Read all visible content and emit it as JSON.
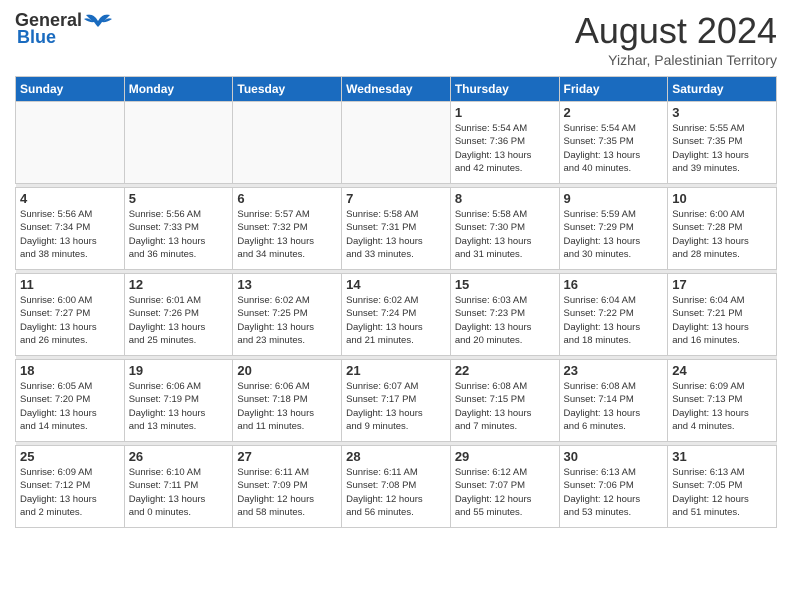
{
  "header": {
    "logo_general": "General",
    "logo_blue": "Blue",
    "month_year": "August 2024",
    "location": "Yizhar, Palestinian Territory"
  },
  "weekdays": [
    "Sunday",
    "Monday",
    "Tuesday",
    "Wednesday",
    "Thursday",
    "Friday",
    "Saturday"
  ],
  "weeks": [
    [
      {
        "day": "",
        "info": ""
      },
      {
        "day": "",
        "info": ""
      },
      {
        "day": "",
        "info": ""
      },
      {
        "day": "",
        "info": ""
      },
      {
        "day": "1",
        "info": "Sunrise: 5:54 AM\nSunset: 7:36 PM\nDaylight: 13 hours\nand 42 minutes."
      },
      {
        "day": "2",
        "info": "Sunrise: 5:54 AM\nSunset: 7:35 PM\nDaylight: 13 hours\nand 40 minutes."
      },
      {
        "day": "3",
        "info": "Sunrise: 5:55 AM\nSunset: 7:35 PM\nDaylight: 13 hours\nand 39 minutes."
      }
    ],
    [
      {
        "day": "4",
        "info": "Sunrise: 5:56 AM\nSunset: 7:34 PM\nDaylight: 13 hours\nand 38 minutes."
      },
      {
        "day": "5",
        "info": "Sunrise: 5:56 AM\nSunset: 7:33 PM\nDaylight: 13 hours\nand 36 minutes."
      },
      {
        "day": "6",
        "info": "Sunrise: 5:57 AM\nSunset: 7:32 PM\nDaylight: 13 hours\nand 34 minutes."
      },
      {
        "day": "7",
        "info": "Sunrise: 5:58 AM\nSunset: 7:31 PM\nDaylight: 13 hours\nand 33 minutes."
      },
      {
        "day": "8",
        "info": "Sunrise: 5:58 AM\nSunset: 7:30 PM\nDaylight: 13 hours\nand 31 minutes."
      },
      {
        "day": "9",
        "info": "Sunrise: 5:59 AM\nSunset: 7:29 PM\nDaylight: 13 hours\nand 30 minutes."
      },
      {
        "day": "10",
        "info": "Sunrise: 6:00 AM\nSunset: 7:28 PM\nDaylight: 13 hours\nand 28 minutes."
      }
    ],
    [
      {
        "day": "11",
        "info": "Sunrise: 6:00 AM\nSunset: 7:27 PM\nDaylight: 13 hours\nand 26 minutes."
      },
      {
        "day": "12",
        "info": "Sunrise: 6:01 AM\nSunset: 7:26 PM\nDaylight: 13 hours\nand 25 minutes."
      },
      {
        "day": "13",
        "info": "Sunrise: 6:02 AM\nSunset: 7:25 PM\nDaylight: 13 hours\nand 23 minutes."
      },
      {
        "day": "14",
        "info": "Sunrise: 6:02 AM\nSunset: 7:24 PM\nDaylight: 13 hours\nand 21 minutes."
      },
      {
        "day": "15",
        "info": "Sunrise: 6:03 AM\nSunset: 7:23 PM\nDaylight: 13 hours\nand 20 minutes."
      },
      {
        "day": "16",
        "info": "Sunrise: 6:04 AM\nSunset: 7:22 PM\nDaylight: 13 hours\nand 18 minutes."
      },
      {
        "day": "17",
        "info": "Sunrise: 6:04 AM\nSunset: 7:21 PM\nDaylight: 13 hours\nand 16 minutes."
      }
    ],
    [
      {
        "day": "18",
        "info": "Sunrise: 6:05 AM\nSunset: 7:20 PM\nDaylight: 13 hours\nand 14 minutes."
      },
      {
        "day": "19",
        "info": "Sunrise: 6:06 AM\nSunset: 7:19 PM\nDaylight: 13 hours\nand 13 minutes."
      },
      {
        "day": "20",
        "info": "Sunrise: 6:06 AM\nSunset: 7:18 PM\nDaylight: 13 hours\nand 11 minutes."
      },
      {
        "day": "21",
        "info": "Sunrise: 6:07 AM\nSunset: 7:17 PM\nDaylight: 13 hours\nand 9 minutes."
      },
      {
        "day": "22",
        "info": "Sunrise: 6:08 AM\nSunset: 7:15 PM\nDaylight: 13 hours\nand 7 minutes."
      },
      {
        "day": "23",
        "info": "Sunrise: 6:08 AM\nSunset: 7:14 PM\nDaylight: 13 hours\nand 6 minutes."
      },
      {
        "day": "24",
        "info": "Sunrise: 6:09 AM\nSunset: 7:13 PM\nDaylight: 13 hours\nand 4 minutes."
      }
    ],
    [
      {
        "day": "25",
        "info": "Sunrise: 6:09 AM\nSunset: 7:12 PM\nDaylight: 13 hours\nand 2 minutes."
      },
      {
        "day": "26",
        "info": "Sunrise: 6:10 AM\nSunset: 7:11 PM\nDaylight: 13 hours\nand 0 minutes."
      },
      {
        "day": "27",
        "info": "Sunrise: 6:11 AM\nSunset: 7:09 PM\nDaylight: 12 hours\nand 58 minutes."
      },
      {
        "day": "28",
        "info": "Sunrise: 6:11 AM\nSunset: 7:08 PM\nDaylight: 12 hours\nand 56 minutes."
      },
      {
        "day": "29",
        "info": "Sunrise: 6:12 AM\nSunset: 7:07 PM\nDaylight: 12 hours\nand 55 minutes."
      },
      {
        "day": "30",
        "info": "Sunrise: 6:13 AM\nSunset: 7:06 PM\nDaylight: 12 hours\nand 53 minutes."
      },
      {
        "day": "31",
        "info": "Sunrise: 6:13 AM\nSunset: 7:05 PM\nDaylight: 12 hours\nand 51 minutes."
      }
    ]
  ]
}
